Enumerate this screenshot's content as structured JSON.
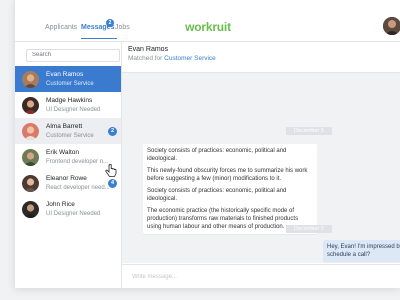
{
  "nav": {
    "tabs": [
      {
        "label": "Applicants"
      },
      {
        "label": "Messages",
        "badge": "2"
      },
      {
        "label": "Jobs"
      }
    ],
    "logo": "workruit"
  },
  "sidebar": {
    "search_placeholder": "Search",
    "conversations": [
      {
        "name": "Evan Ramos",
        "subtitle": "Customer Service",
        "state": "active"
      },
      {
        "name": "Madge Hawkins",
        "subtitle": "UI Designer Needed"
      },
      {
        "name": "Alma Barrett",
        "subtitle": "Customer Service",
        "badge": "2",
        "state": "hover"
      },
      {
        "name": "Erik Walton",
        "subtitle": "Frontend developer n..."
      },
      {
        "name": "Eleanor Rowe",
        "subtitle": "React developer need...",
        "badge": "4"
      },
      {
        "name": "John Rice",
        "subtitle": "UI Designer Needed"
      }
    ]
  },
  "chat": {
    "contact_name": "Evan Ramos",
    "matched_prefix": "Matched for",
    "matched_role": "Customer Service",
    "dates": [
      "December 5",
      "December 5"
    ],
    "messages": [
      {
        "text": [
          "Society consists of practices: economic, political and ideological."
        ]
      },
      {
        "text": [
          "This newly-found obscurity forces me to summarize his work before suggesting a few (minor) modifications to it.",
          "Society consists of practices: economic, political and ideological.",
          "The economic practice (the historically specific mode of production) transforms raw materials to finished products using human labour and other means of production."
        ]
      },
      {
        "text": [
          "Hey, Evan! I'm impressed by your i",
          "schedule a call?"
        ],
        "outgoing": true
      }
    ],
    "composer_placeholder": "Write message..."
  },
  "colors": {
    "accent": "#3b7fd1",
    "brand": "#6bbd4d",
    "active_row": "#3a7bd0"
  }
}
